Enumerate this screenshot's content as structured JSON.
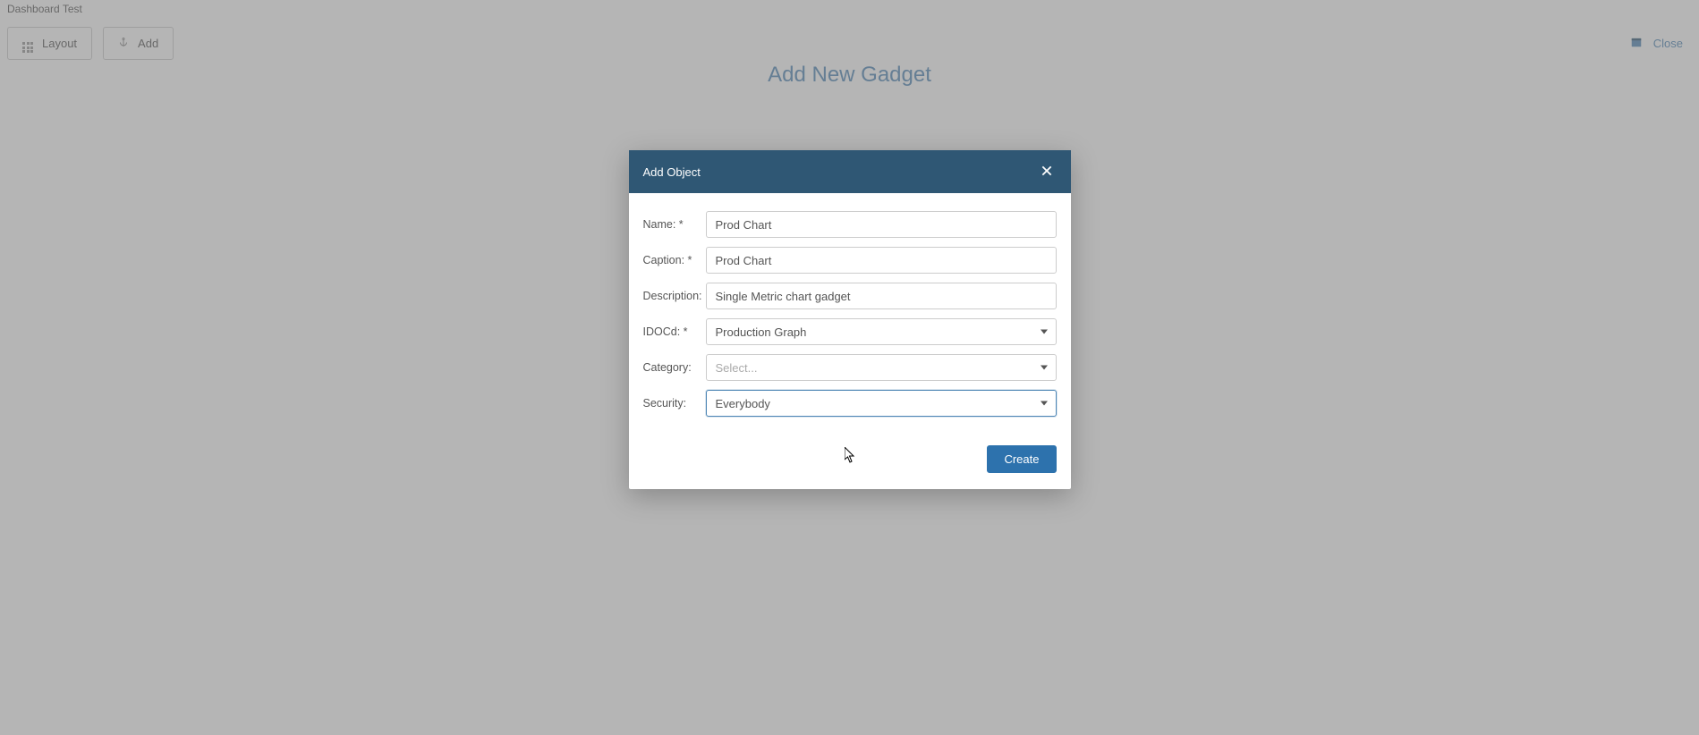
{
  "breadcrumb": "Dashboard Test",
  "toolbar": {
    "layout_label": "Layout",
    "add_label": "Add"
  },
  "close_label": "Close",
  "page_title": "Add New Gadget",
  "modal": {
    "title": "Add Object",
    "fields": {
      "name": {
        "label": "Name: *",
        "value": "Prod Chart"
      },
      "caption": {
        "label": "Caption: *",
        "value": "Prod Chart"
      },
      "description": {
        "label": "Description:",
        "value": "Single Metric chart gadget"
      },
      "idocd": {
        "label": "IDOCd: *",
        "value": "Production Graph"
      },
      "category": {
        "label": "Category:",
        "placeholder": "Select..."
      },
      "security": {
        "label": "Security:",
        "value": "Everybody"
      }
    },
    "create_label": "Create"
  }
}
